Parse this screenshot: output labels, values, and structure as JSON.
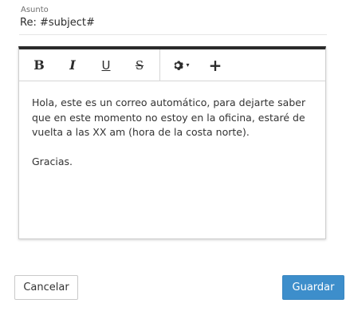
{
  "subject": {
    "label": "Asunto",
    "value": "Re: #subject#"
  },
  "toolbar": {
    "bold": "B",
    "italic": "I",
    "underline": "U",
    "strikethrough": "S",
    "gear_icon": "gear-icon",
    "caret": "▾",
    "plus": "+"
  },
  "message": {
    "paragraph_1": "Hola, este es un correo automático, para dejarte saber que en este momento no estoy en la oficina, estaré de vuelta a las XX am (hora de la costa norte).",
    "paragraph_2": "Gracias."
  },
  "actions": {
    "cancel_label": "Cancelar",
    "save_label": "Guardar"
  },
  "colors": {
    "primary": "#3d8ecb",
    "toolbar_top_border": "#2b2b2b"
  }
}
